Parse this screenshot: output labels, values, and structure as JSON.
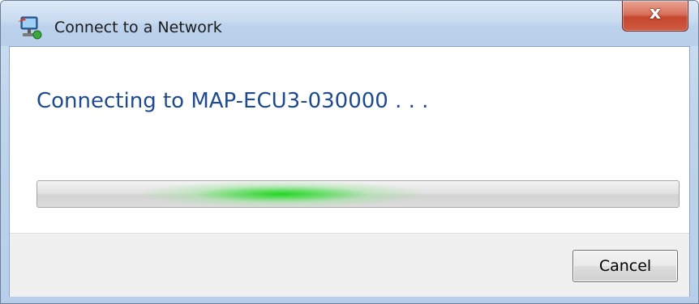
{
  "window": {
    "title": "Connect to a Network",
    "close_label": "x"
  },
  "main": {
    "message": "Connecting to MAP-ECU3-030000 . . ."
  },
  "progress": {
    "state": "indeterminate",
    "glow_center_fraction": 0.38,
    "accent_color": "#21d621"
  },
  "footer": {
    "cancel_label": "Cancel"
  },
  "icons": {
    "title": "network-icon",
    "close": "close-icon"
  }
}
